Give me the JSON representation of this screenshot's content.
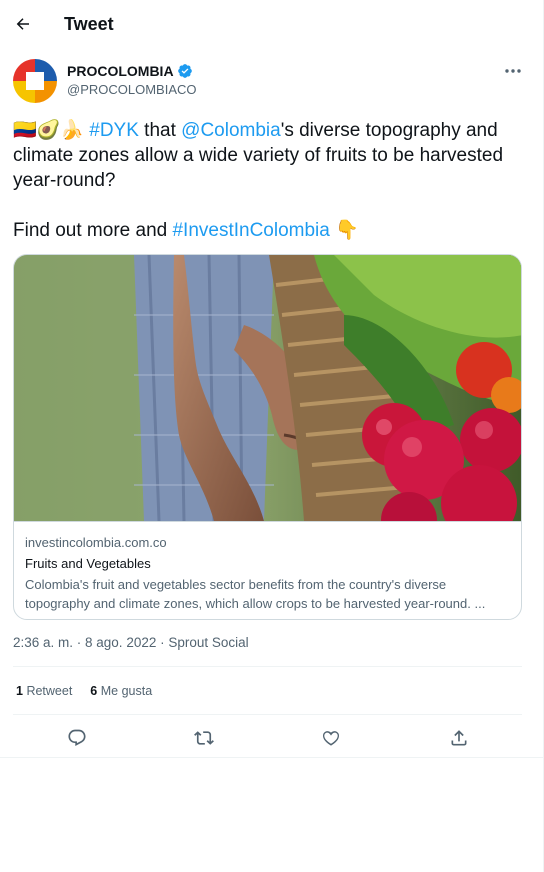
{
  "header": {
    "title": "Tweet",
    "back_icon": "arrow-left-icon"
  },
  "author": {
    "name": "PROCOLOMBIA",
    "handle": "@PROCOLOMBIACO",
    "verified_icon": "verified-badge-icon",
    "more_icon": "more-horizontal-icon"
  },
  "tweet": {
    "emojis": "🇨🇴🥑🍌",
    "hashtag_dyk": "#DYK",
    "text_1": " that ",
    "mention": "@Colombia",
    "text_2": "'s diverse topography and climate zones allow a wide variety of fruits to be harvested year-round?",
    "text_3": "Find out more and ",
    "hashtag_invest": "#InvestInColombia",
    "pointing_emoji": "👇"
  },
  "card": {
    "domain": "investincolombia.com.co",
    "title": "Fruits and Vegetables",
    "description": "Colombia's fruit and vegetables sector benefits from the country's diverse topography and climate zones, which allow crops to be harvested year-round. ..."
  },
  "meta": {
    "timestamp": "2:36 a. m. · 8 ago. 2022 · Sprout Social"
  },
  "stats": {
    "retweets_count": "1",
    "retweets_label": "Retweet",
    "likes_count": "6",
    "likes_label": "Me gusta"
  },
  "actions": [
    "reply-icon",
    "retweet-icon",
    "like-icon",
    "share-icon"
  ],
  "colors": {
    "link": "#1d9bf0",
    "text": "#0f1419",
    "secondary": "#536471",
    "border": "#cfd9de"
  }
}
